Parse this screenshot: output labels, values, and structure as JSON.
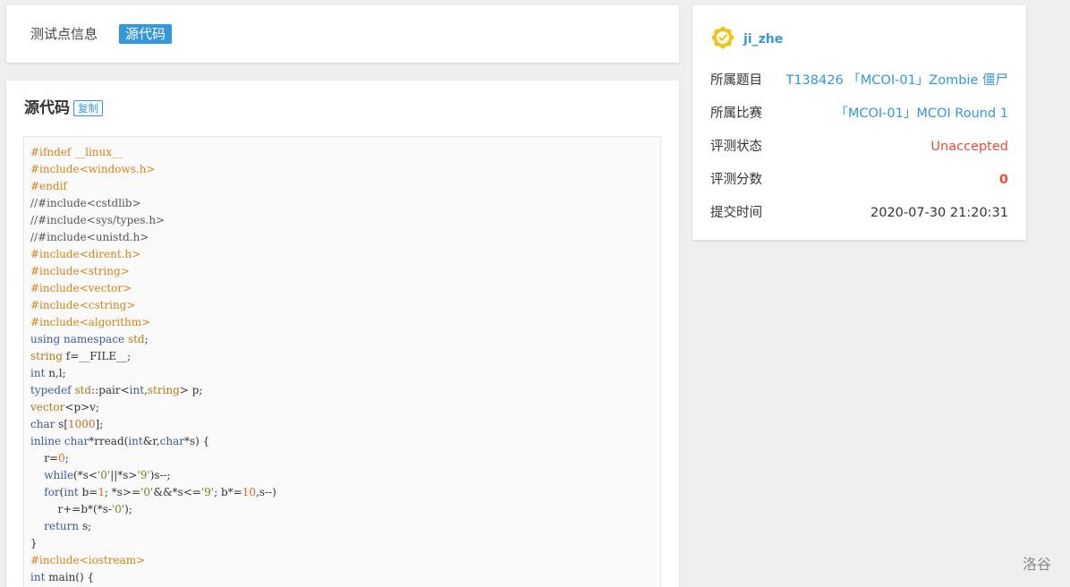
{
  "tabs": {
    "info_label": "测试点信息",
    "source_label": "源代码"
  },
  "source": {
    "title": "源代码",
    "copy_label": "复制",
    "lines": [
      [
        {
          "t": "#ifndef __linux__",
          "c": "pp"
        }
      ],
      [
        {
          "t": "#include<windows.h>",
          "c": "pp"
        }
      ],
      [
        {
          "t": "#endif",
          "c": "pp"
        }
      ],
      [
        {
          "t": "//#include<cstdlib>",
          "c": "cm"
        }
      ],
      [
        {
          "t": "//#include<sys/types.h>",
          "c": "cm"
        }
      ],
      [
        {
          "t": "//#include<unistd.h>",
          "c": "cm"
        }
      ],
      [
        {
          "t": "#include<dirent.h>",
          "c": "pp"
        }
      ],
      [
        {
          "t": "#include<string>",
          "c": "pp"
        }
      ],
      [
        {
          "t": "#include<vector>",
          "c": "pp"
        }
      ],
      [
        {
          "t": "#include<cstring>",
          "c": "pp"
        }
      ],
      [
        {
          "t": "#include<algorithm>",
          "c": "pp"
        }
      ],
      [
        {
          "t": "using namespace ",
          "c": "kw"
        },
        {
          "t": "std",
          "c": "ty"
        },
        {
          "t": ";",
          "c": "op"
        }
      ],
      [
        {
          "t": "string",
          "c": "ty"
        },
        {
          "t": " f=__FILE__;",
          "c": "op"
        }
      ],
      [
        {
          "t": "int",
          "c": "kw"
        },
        {
          "t": " n,l;",
          "c": "op"
        }
      ],
      [
        {
          "t": "typedef ",
          "c": "kw"
        },
        {
          "t": "std",
          "c": "ty"
        },
        {
          "t": "::pair<",
          "c": "op"
        },
        {
          "t": "int",
          "c": "kw"
        },
        {
          "t": ",",
          "c": "op"
        },
        {
          "t": "string",
          "c": "ty"
        },
        {
          "t": "> p;",
          "c": "op"
        }
      ],
      [
        {
          "t": "vector",
          "c": "ty"
        },
        {
          "t": "<p>v;",
          "c": "op"
        }
      ],
      [
        {
          "t": "char",
          "c": "kw"
        },
        {
          "t": " s[",
          "c": "op"
        },
        {
          "t": "1000",
          "c": "nm"
        },
        {
          "t": "];",
          "c": "op"
        }
      ],
      [
        {
          "t": "inline char",
          "c": "kw"
        },
        {
          "t": "*rread(",
          "c": "op"
        },
        {
          "t": "int",
          "c": "kw"
        },
        {
          "t": "&r,",
          "c": "op"
        },
        {
          "t": "char",
          "c": "kw"
        },
        {
          "t": "*s) {",
          "c": "op"
        }
      ],
      [
        {
          "t": "    r=",
          "c": "op"
        },
        {
          "t": "0",
          "c": "nm"
        },
        {
          "t": ";",
          "c": "op"
        }
      ],
      [
        {
          "t": "    ",
          "c": "op"
        },
        {
          "t": "while",
          "c": "kw"
        },
        {
          "t": "(*s<",
          "c": "op"
        },
        {
          "t": "'0'",
          "c": "st"
        },
        {
          "t": "||*s>",
          "c": "op"
        },
        {
          "t": "'9'",
          "c": "st"
        },
        {
          "t": ")s--;",
          "c": "op"
        }
      ],
      [
        {
          "t": "    ",
          "c": "op"
        },
        {
          "t": "for",
          "c": "kw"
        },
        {
          "t": "(",
          "c": "op"
        },
        {
          "t": "int",
          "c": "kw"
        },
        {
          "t": " b=",
          "c": "op"
        },
        {
          "t": "1",
          "c": "nm"
        },
        {
          "t": "; *s>=",
          "c": "op"
        },
        {
          "t": "'0'",
          "c": "st"
        },
        {
          "t": "&&*s<=",
          "c": "op"
        },
        {
          "t": "'9'",
          "c": "st"
        },
        {
          "t": "; b*=",
          "c": "op"
        },
        {
          "t": "10",
          "c": "nm"
        },
        {
          "t": ",s--)",
          "c": "op"
        }
      ],
      [
        {
          "t": "        r+=b*(*s-",
          "c": "op"
        },
        {
          "t": "'0'",
          "c": "st"
        },
        {
          "t": ");",
          "c": "op"
        }
      ],
      [
        {
          "t": "    ",
          "c": "op"
        },
        {
          "t": "return",
          "c": "kw"
        },
        {
          "t": " s;",
          "c": "op"
        }
      ],
      [
        {
          "t": "}",
          "c": "op"
        }
      ],
      [
        {
          "t": "#include<iostream>",
          "c": "pp"
        }
      ],
      [
        {
          "t": "int",
          "c": "kw"
        },
        {
          "t": " main() {",
          "c": "op"
        }
      ]
    ]
  },
  "record": {
    "user": "ji_zhe",
    "rows": [
      {
        "label": "所属题目",
        "value": "T138426 「MCOI-01」Zombie 僵尸",
        "style": "link"
      },
      {
        "label": "所属比赛",
        "value": "「MCOI-01」MCOI Round 1",
        "style": "link"
      },
      {
        "label": "评测状态",
        "value": "Unaccepted",
        "style": "red"
      },
      {
        "label": "评测分数",
        "value": "0",
        "style": "red-bold"
      },
      {
        "label": "提交时间",
        "value": "2020-07-30 21:20:31",
        "style": "plain"
      }
    ]
  },
  "footer": {
    "watermark": "洛谷"
  },
  "colors": {
    "accent": "#3498db",
    "error": "#e74c3c",
    "badge": "#f1c40f"
  },
  "icons": {
    "user_badge": "verified-badge-icon"
  }
}
